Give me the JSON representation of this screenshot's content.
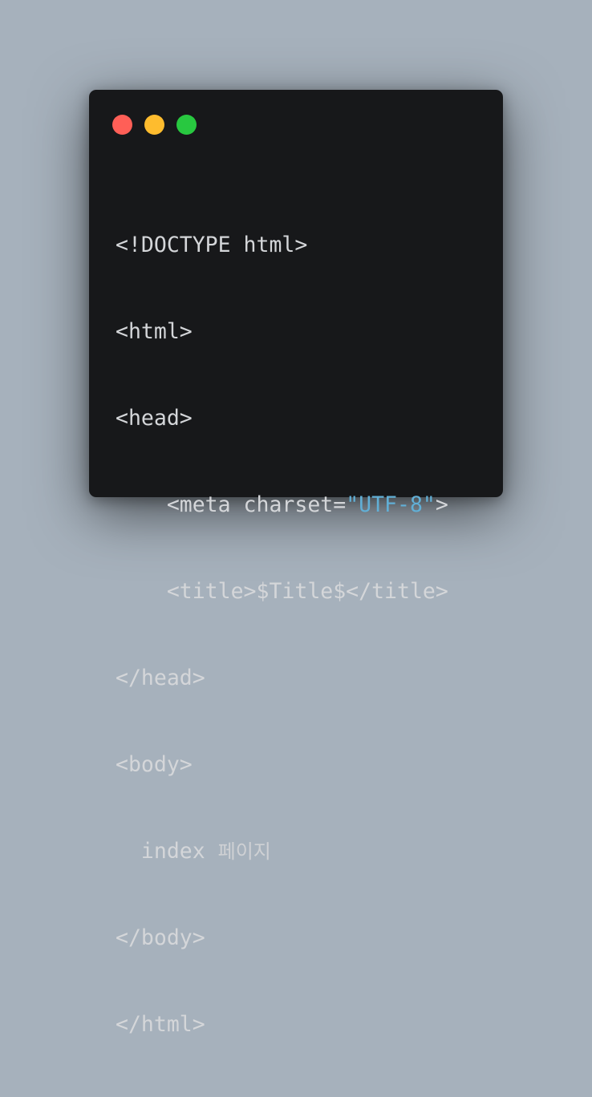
{
  "window": {
    "controls": {
      "close": "close",
      "minimize": "minimize",
      "zoom": "zoom"
    }
  },
  "code": {
    "lines": [
      "<!DOCTYPE html>",
      "<html>",
      "<head>",
      "    <meta charset=",
      "\"UTF-8\"",
      ">",
      "    <title>$Title$</title>",
      "</head>",
      "<body>",
      "  index ",
      "페이지",
      "</body>",
      "</html>"
    ]
  },
  "colors": {
    "background": "#a6b1bc",
    "window": "#17181a",
    "text": "#d4d6d9",
    "string": "#61afd6",
    "red": "#ff5f57",
    "yellow": "#febc2e",
    "green": "#28c840"
  }
}
